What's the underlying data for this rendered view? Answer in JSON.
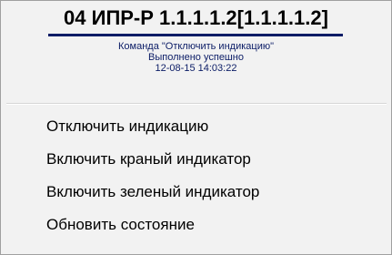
{
  "header": {
    "title": "04 ИПР-Р 1.1.1.1.2[1.1.1.1.2]",
    "status_lines": [
      "Команда \"Отключить индикацию\"",
      "Выполнено успешно",
      "12-08-15 14:03:22"
    ]
  },
  "menu": {
    "items": [
      {
        "label": "Отключить индикацию"
      },
      {
        "label": "Включить краный индикатор"
      },
      {
        "label": "Включить зеленый индикатор"
      },
      {
        "label": "Обновить состояние"
      }
    ]
  },
  "colors": {
    "accent": "#0b1c66",
    "background": "#f2f2f2",
    "border": "#a0a0a0"
  }
}
